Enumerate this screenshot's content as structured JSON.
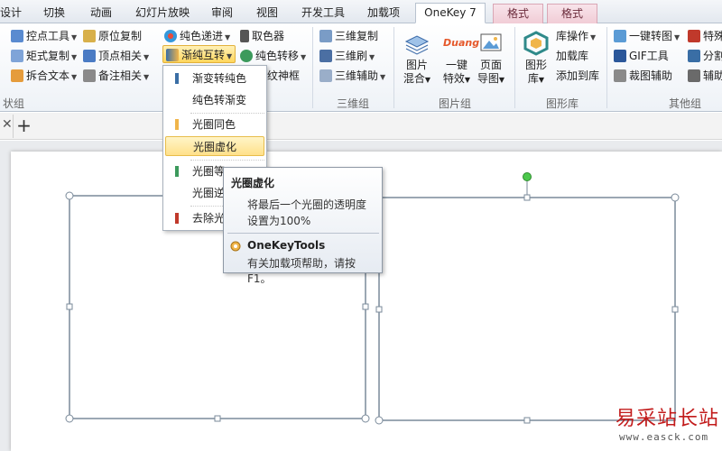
{
  "tabs": [
    "设计",
    "切换",
    "动画",
    "幻灯片放映",
    "审阅",
    "视图",
    "开发工具",
    "加载项",
    "OneKey 7",
    "格式",
    "格式"
  ],
  "ribbon": {
    "col1": [
      "控点工具",
      "矩式复制",
      "拆合文本"
    ],
    "col2": [
      "原位复制",
      "顶点相关",
      "备注相关"
    ],
    "col3": [
      "纯色递进",
      "渐纯互转",
      "取色器",
      "纯色转移",
      "纹神框"
    ],
    "col4": [
      "三维复制",
      "三维刷",
      "三维辅助"
    ],
    "img_big": [
      [
        "图片",
        "混合"
      ],
      [
        "一键",
        "特效"
      ],
      [
        "页面",
        "导图"
      ]
    ],
    "shape_big": [
      "图形",
      "库"
    ],
    "shape_items": [
      "库操作",
      "加载库",
      "添加到库"
    ],
    "other_items": [
      "一键转图",
      "GIF工具",
      "裁图辅助"
    ],
    "right_items": [
      "特殊",
      "分割",
      "辅助"
    ],
    "group_labels": [
      "状组",
      "三维组",
      "图片组",
      "图形库",
      "其他组"
    ],
    "duang_logo": "Duang"
  },
  "menu": {
    "items": [
      "渐变转纯色",
      "纯色转渐变",
      "光圈同色",
      "光圈虚化",
      "光圈等",
      "光圈逆",
      "去除光"
    ],
    "marker_colors": [
      "#3a6ea5",
      "#ffffff",
      "#f0b54a",
      "#ffffff",
      "#3c9a5c",
      "#ffffff",
      "#c0392b"
    ]
  },
  "tooltip": {
    "title": "光圈虚化",
    "desc": "将最后一个光圈的透明度设置为100%",
    "plugin": "OneKeyTools",
    "help": "有关加载项帮助，请按 F1。"
  },
  "watermark": {
    "cn": "易采站长站",
    "url": "www.easck.com"
  },
  "colors": {
    "accent": "#2b579a",
    "highlight": "#ffd65c",
    "context_tab": "#f1ccd6",
    "handle_green": "#4cc84c"
  }
}
